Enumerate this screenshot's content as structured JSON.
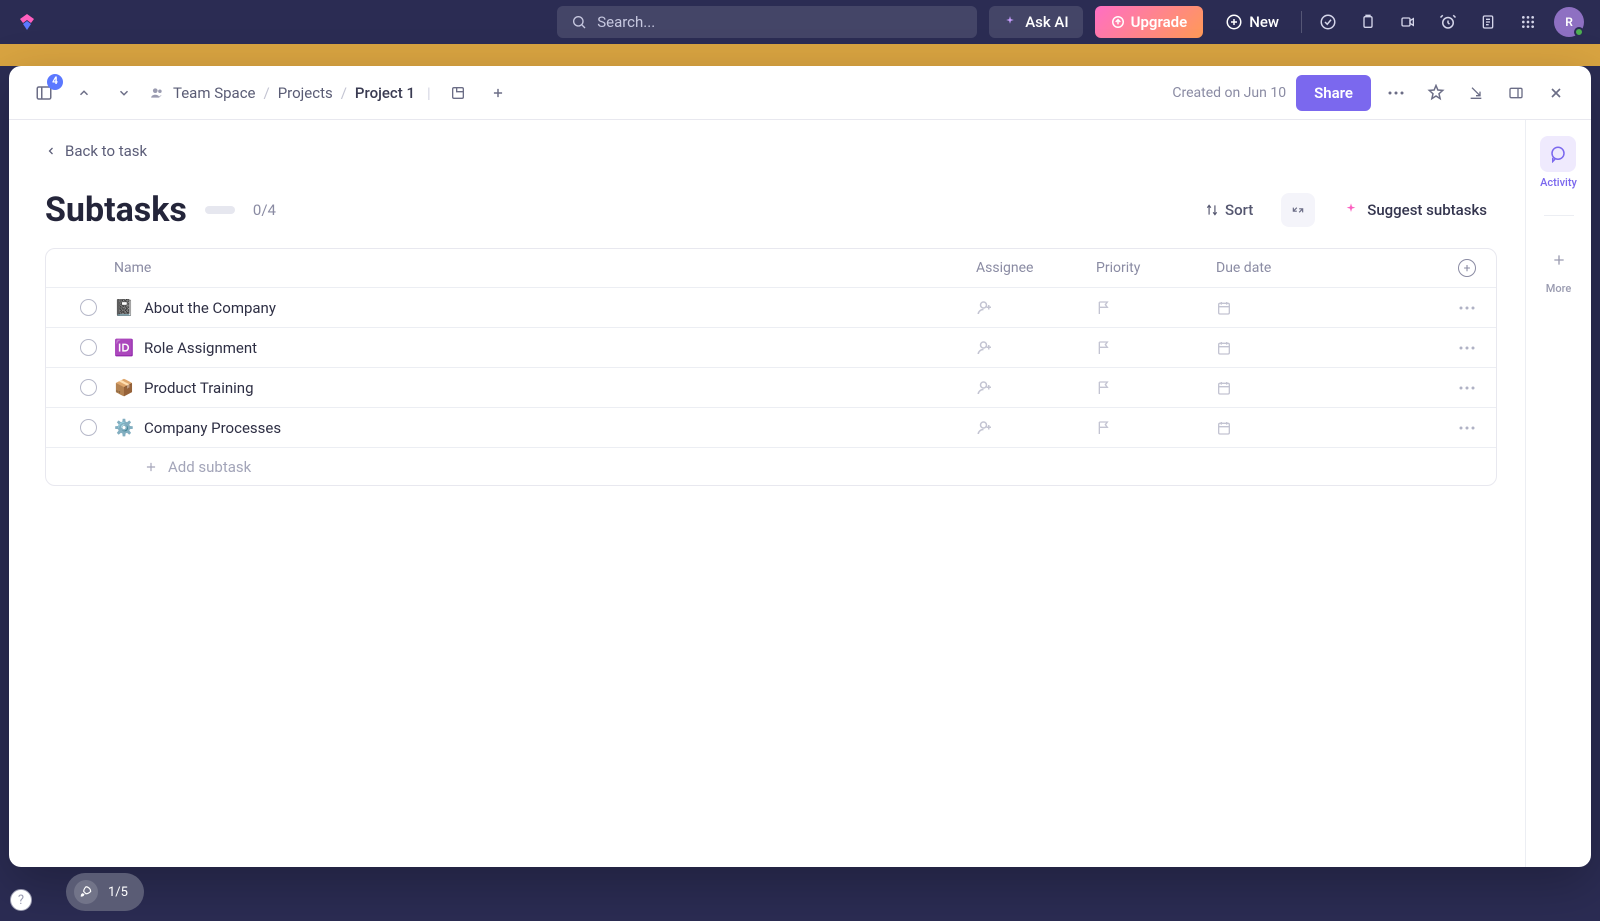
{
  "topbar": {
    "search_placeholder": "Search...",
    "ask_ai_label": "Ask AI",
    "upgrade_label": "Upgrade",
    "new_label": "New",
    "avatar_initial": "R"
  },
  "modal_header": {
    "task_count_badge": "4",
    "breadcrumb": {
      "space": "Team Space",
      "projects": "Projects",
      "current": "Project 1"
    },
    "created_text": "Created on Jun 10",
    "share_label": "Share"
  },
  "page": {
    "back_label": "Back to task",
    "title": "Subtasks",
    "progress_count": "0/4",
    "sort_label": "Sort",
    "suggest_label": "Suggest subtasks",
    "columns": {
      "name": "Name",
      "assignee": "Assignee",
      "priority": "Priority",
      "due_date": "Due date"
    },
    "subtasks": [
      {
        "emoji": "📓",
        "name": "About the Company"
      },
      {
        "emoji": "🆔",
        "name": "Role Assignment"
      },
      {
        "emoji": "📦",
        "name": "Product Training"
      },
      {
        "emoji": "⚙️",
        "name": "Company Processes"
      }
    ],
    "add_subtask_label": "Add subtask"
  },
  "right_rail": {
    "activity_label": "Activity",
    "more_label": "More"
  },
  "footer": {
    "onboarding_progress": "1/5"
  }
}
